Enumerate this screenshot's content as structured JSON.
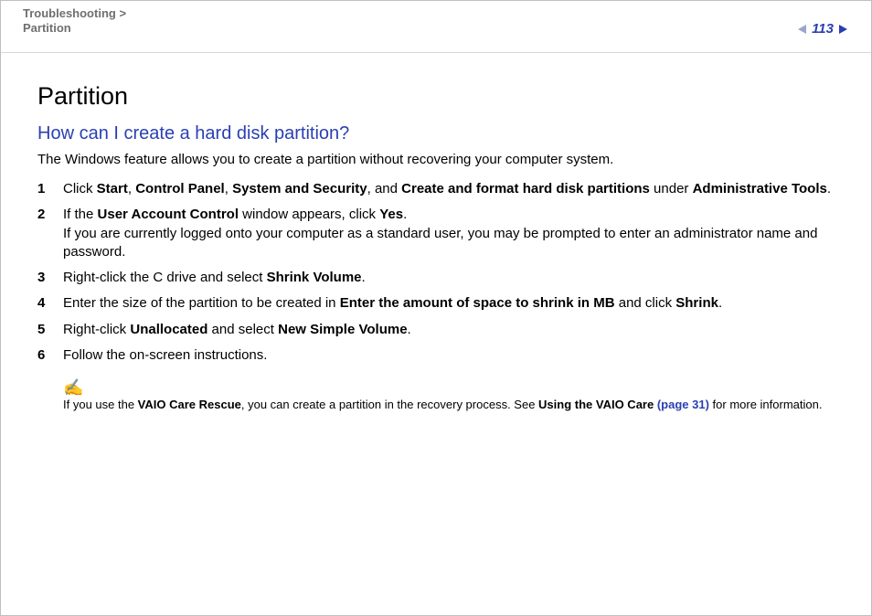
{
  "header": {
    "breadcrumb_1": "Troubleshooting",
    "breadcrumb_sep": " > ",
    "breadcrumb_2": "Partition",
    "page_number": "113"
  },
  "title": "Partition",
  "question": "How can I create a hard disk partition?",
  "intro": "The Windows feature allows you to create a partition without recovering your computer system.",
  "steps": [
    {
      "pre1": "Click ",
      "b1": "Start",
      "sep1": ", ",
      "b2": "Control Panel",
      "sep2": ", ",
      "b3": "System and Security",
      "sep3": ", and ",
      "b4": "Create and format hard disk partitions",
      "sep4": " under ",
      "b5": "Administrative Tools",
      "post": "."
    },
    {
      "line1_pre": "If the ",
      "line1_b1": "User Account Control",
      "line1_mid": " window appears, click ",
      "line1_b2": "Yes",
      "line1_post": ".",
      "line2": "If you are currently logged onto your computer as a standard user, you may be prompted to enter an administrator name and password."
    },
    {
      "pre": "Right-click the C drive and select ",
      "b1": "Shrink Volume",
      "post": "."
    },
    {
      "pre": "Enter the size of the partition to be created in ",
      "b1": "Enter the amount of space to shrink in MB",
      "mid": " and click ",
      "b2": "Shrink",
      "post": "."
    },
    {
      "pre": "Right-click ",
      "b1": "Unallocated",
      "mid": " and select ",
      "b2": "New Simple Volume",
      "post": "."
    },
    {
      "text": "Follow the on-screen instructions."
    }
  ],
  "note": {
    "icon": "✍",
    "pre": "If you use the ",
    "b1": "VAIO Care Rescue",
    "mid": ", you can create a partition in the recovery process. See ",
    "b2": "Using the VAIO Care ",
    "link": "(page 31)",
    "post": " for more information."
  }
}
